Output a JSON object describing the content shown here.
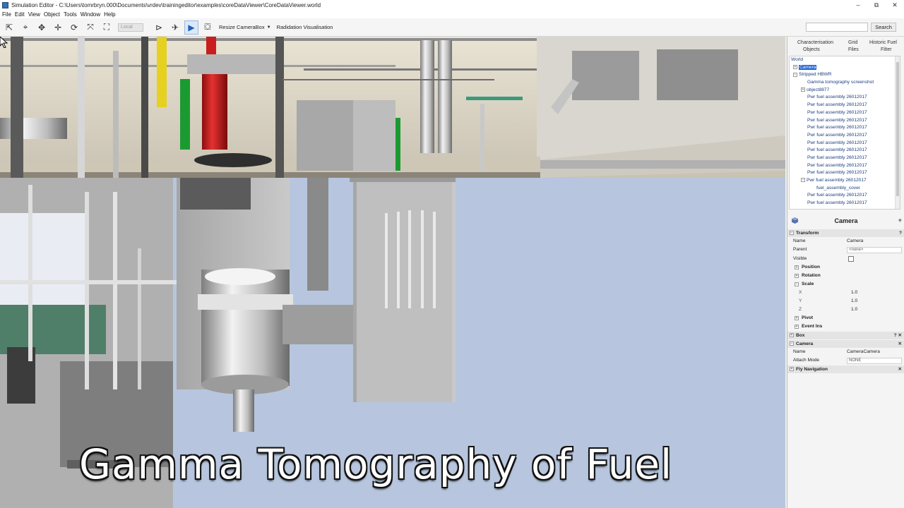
{
  "window": {
    "title": "Simulation Editor - C:\\Users\\tomrbryn.000\\Documents\\vrdev\\trainingeditor\\examples\\coreDataViewer\\CoreDataViewer.world",
    "controls": [
      "–",
      "⧉",
      "✕"
    ]
  },
  "menu": [
    "File",
    "Edit",
    "View",
    "Object",
    "Tools",
    "Window",
    "Help"
  ],
  "toolbar": {
    "local_label": "Local",
    "resize_camerabox": "Resize CameraBox",
    "radiation_label": "Radidation Visualisation",
    "search_button": "Search",
    "search_placeholder": ""
  },
  "viewport": {
    "caption": "Gamma Tomography of Fuel",
    "sky_color": "#b7c6de"
  },
  "tabs": {
    "characterisation": "Characterisation",
    "grid": "Grid",
    "historic_fuel": "Historic Fuel",
    "objects": "Objects",
    "files": "Files",
    "filter": "Filter"
  },
  "tree": {
    "root": "World",
    "camera": "Camera",
    "stripped": "Stripped HBWR",
    "screenshot": "Gamma tomography screenshot",
    "object": "object8877",
    "assemblies": [
      "Pwr fuel assembly 26012017",
      "Pwr fuel assembly 26012017",
      "Pwr fuel assembly 26012017",
      "Pwr fuel assembly 26012017",
      "Pwr fuel assembly 26012017",
      "Pwr fuel assembly 26012017",
      "Pwr fuel assembly 26012017",
      "Pwr fuel assembly 26012017",
      "Pwr fuel assembly 26012017",
      "Pwr fuel assembly 26012017",
      "Pwr fuel assembly 26012017",
      "Pwr fuel assembly 26012017"
    ],
    "cover": "fuel_assembly_cover",
    "after_cover": [
      "Pwr fuel assembly 26012017",
      "Pwr fuel assembly 26012017"
    ]
  },
  "properties": {
    "title": "Camera",
    "transform": "Transform",
    "name_label": "Name",
    "name_value": "Camera",
    "parent_label": "Parent",
    "parent_value": "<none>",
    "visible_label": "Visible",
    "position": "Position",
    "rotation": "Rotation",
    "scale": "Scale",
    "x_label": "X",
    "x_value": "1.0",
    "y_label": "Y",
    "y_value": "1.0",
    "z_label": "Z",
    "z_value": "1.0",
    "pivot": "Pivot",
    "event_ins": "Event Ins",
    "box": "Box",
    "box_icons": "? ✕",
    "camera_section": "Camera",
    "camera_close": "✕",
    "cam_name_label": "Name",
    "cam_name_value": "CameraCamera",
    "attach_label": "Attach Mode",
    "attach_value": "NONE",
    "fly_navigation": "Fly Navigation",
    "fly_close": "✕",
    "help_icon": "?",
    "add_icon": "+"
  }
}
